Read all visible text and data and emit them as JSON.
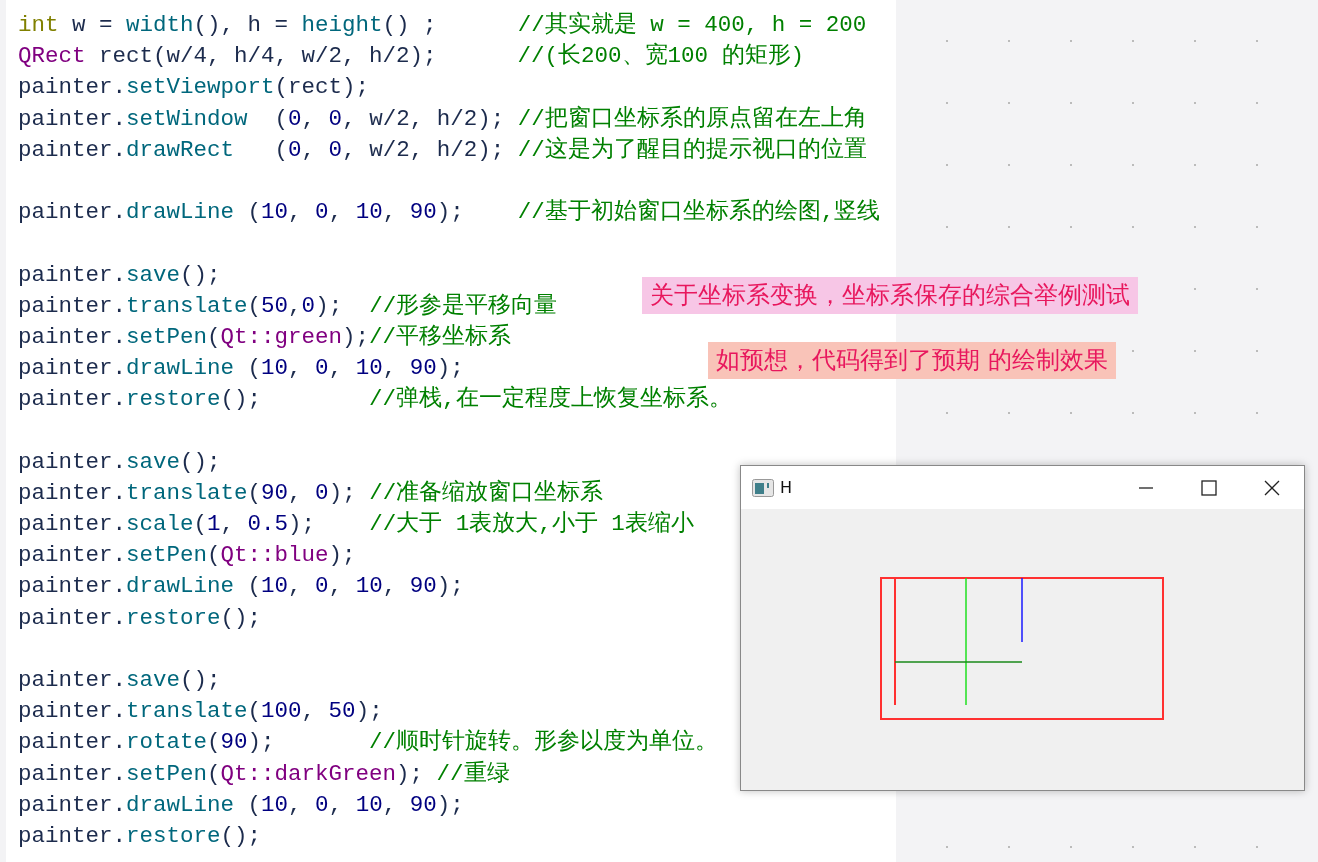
{
  "code_lines": [
    {
      "kind": "code",
      "tokens": [
        {
          "kind": "kw",
          "text": "int"
        },
        {
          "kind": "var",
          "text": " w = "
        },
        {
          "kind": "fn",
          "text": "width"
        },
        {
          "kind": "var",
          "text": "(), h = "
        },
        {
          "kind": "fn",
          "text": "height"
        },
        {
          "kind": "var",
          "text": "() ;      "
        },
        {
          "kind": "com",
          "text": "//其实就是 w = 400, h = 200"
        }
      ]
    },
    {
      "kind": "code",
      "tokens": [
        {
          "kind": "type",
          "text": "QRect"
        },
        {
          "kind": "var",
          "text": " rect(w/4, h/4, w/2, h/2);      "
        },
        {
          "kind": "com",
          "text": "//(长200、宽100 的矩形)"
        }
      ]
    },
    {
      "kind": "code",
      "tokens": [
        {
          "kind": "var",
          "text": "painter."
        },
        {
          "kind": "fn",
          "text": "setViewport"
        },
        {
          "kind": "var",
          "text": "(rect);"
        }
      ]
    },
    {
      "kind": "code",
      "tokens": [
        {
          "kind": "var",
          "text": "painter."
        },
        {
          "kind": "fn",
          "text": "setWindow"
        },
        {
          "kind": "var",
          "text": "  ("
        },
        {
          "kind": "num",
          "text": "0"
        },
        {
          "kind": "var",
          "text": ", "
        },
        {
          "kind": "num",
          "text": "0"
        },
        {
          "kind": "var",
          "text": ", w/2, h/2); "
        },
        {
          "kind": "com",
          "text": "//把窗口坐标系的原点留在左上角"
        }
      ]
    },
    {
      "kind": "code",
      "tokens": [
        {
          "kind": "var",
          "text": "painter."
        },
        {
          "kind": "fn",
          "text": "drawRect"
        },
        {
          "kind": "var",
          "text": "   ("
        },
        {
          "kind": "num",
          "text": "0"
        },
        {
          "kind": "var",
          "text": ", "
        },
        {
          "kind": "num",
          "text": "0"
        },
        {
          "kind": "var",
          "text": ", w/2, h/2); "
        },
        {
          "kind": "com",
          "text": "//这是为了醒目的提示视口的位置"
        }
      ]
    },
    {
      "kind": "blank"
    },
    {
      "kind": "code",
      "tokens": [
        {
          "kind": "var",
          "text": "painter."
        },
        {
          "kind": "fn",
          "text": "drawLine"
        },
        {
          "kind": "var",
          "text": " ("
        },
        {
          "kind": "num",
          "text": "10"
        },
        {
          "kind": "var",
          "text": ", "
        },
        {
          "kind": "num",
          "text": "0"
        },
        {
          "kind": "var",
          "text": ", "
        },
        {
          "kind": "num",
          "text": "10"
        },
        {
          "kind": "var",
          "text": ", "
        },
        {
          "kind": "num",
          "text": "90"
        },
        {
          "kind": "var",
          "text": ");    "
        },
        {
          "kind": "com",
          "text": "//基于初始窗口坐标系的绘图,竖线"
        }
      ]
    },
    {
      "kind": "blank"
    },
    {
      "kind": "code",
      "tokens": [
        {
          "kind": "var",
          "text": "painter."
        },
        {
          "kind": "fn",
          "text": "save"
        },
        {
          "kind": "var",
          "text": "();"
        }
      ]
    },
    {
      "kind": "code",
      "tokens": [
        {
          "kind": "var",
          "text": "painter."
        },
        {
          "kind": "fn",
          "text": "translate"
        },
        {
          "kind": "var",
          "text": "("
        },
        {
          "kind": "num",
          "text": "50"
        },
        {
          "kind": "var",
          "text": ","
        },
        {
          "kind": "num",
          "text": "0"
        },
        {
          "kind": "var",
          "text": ");  "
        },
        {
          "kind": "com",
          "text": "//形参是平移向量"
        }
      ]
    },
    {
      "kind": "code",
      "tokens": [
        {
          "kind": "var",
          "text": "painter."
        },
        {
          "kind": "fn",
          "text": "setPen"
        },
        {
          "kind": "var",
          "text": "("
        },
        {
          "kind": "type",
          "text": "Qt::green"
        },
        {
          "kind": "var",
          "text": ");"
        },
        {
          "kind": "com",
          "text": "//平移坐标系"
        }
      ]
    },
    {
      "kind": "code",
      "tokens": [
        {
          "kind": "var",
          "text": "painter."
        },
        {
          "kind": "fn",
          "text": "drawLine"
        },
        {
          "kind": "var",
          "text": " ("
        },
        {
          "kind": "num",
          "text": "10"
        },
        {
          "kind": "var",
          "text": ", "
        },
        {
          "kind": "num",
          "text": "0"
        },
        {
          "kind": "var",
          "text": ", "
        },
        {
          "kind": "num",
          "text": "10"
        },
        {
          "kind": "var",
          "text": ", "
        },
        {
          "kind": "num",
          "text": "90"
        },
        {
          "kind": "var",
          "text": ");"
        }
      ]
    },
    {
      "kind": "code",
      "tokens": [
        {
          "kind": "var",
          "text": "painter."
        },
        {
          "kind": "fn",
          "text": "restore"
        },
        {
          "kind": "var",
          "text": "();        "
        },
        {
          "kind": "com",
          "text": "//弹栈,在一定程度上恢复坐标系。"
        }
      ]
    },
    {
      "kind": "blank"
    },
    {
      "kind": "code",
      "tokens": [
        {
          "kind": "var",
          "text": "painter."
        },
        {
          "kind": "fn",
          "text": "save"
        },
        {
          "kind": "var",
          "text": "();"
        }
      ]
    },
    {
      "kind": "code",
      "tokens": [
        {
          "kind": "var",
          "text": "painter."
        },
        {
          "kind": "fn",
          "text": "translate"
        },
        {
          "kind": "var",
          "text": "("
        },
        {
          "kind": "num",
          "text": "90"
        },
        {
          "kind": "var",
          "text": ", "
        },
        {
          "kind": "num",
          "text": "0"
        },
        {
          "kind": "var",
          "text": "); "
        },
        {
          "kind": "com",
          "text": "//准备缩放窗口坐标系"
        }
      ]
    },
    {
      "kind": "code",
      "tokens": [
        {
          "kind": "var",
          "text": "painter."
        },
        {
          "kind": "fn",
          "text": "scale"
        },
        {
          "kind": "var",
          "text": "("
        },
        {
          "kind": "num",
          "text": "1"
        },
        {
          "kind": "var",
          "text": ", "
        },
        {
          "kind": "num",
          "text": "0.5"
        },
        {
          "kind": "var",
          "text": ");    "
        },
        {
          "kind": "com",
          "text": "//大于 1表放大,小于 1表缩小"
        }
      ]
    },
    {
      "kind": "code",
      "tokens": [
        {
          "kind": "var",
          "text": "painter."
        },
        {
          "kind": "fn",
          "text": "setPen"
        },
        {
          "kind": "var",
          "text": "("
        },
        {
          "kind": "type",
          "text": "Qt::blue"
        },
        {
          "kind": "var",
          "text": ");"
        }
      ]
    },
    {
      "kind": "code",
      "tokens": [
        {
          "kind": "var",
          "text": "painter."
        },
        {
          "kind": "fn",
          "text": "drawLine"
        },
        {
          "kind": "var",
          "text": " ("
        },
        {
          "kind": "num",
          "text": "10"
        },
        {
          "kind": "var",
          "text": ", "
        },
        {
          "kind": "num",
          "text": "0"
        },
        {
          "kind": "var",
          "text": ", "
        },
        {
          "kind": "num",
          "text": "10"
        },
        {
          "kind": "var",
          "text": ", "
        },
        {
          "kind": "num",
          "text": "90"
        },
        {
          "kind": "var",
          "text": ");"
        }
      ]
    },
    {
      "kind": "code",
      "tokens": [
        {
          "kind": "var",
          "text": "painter."
        },
        {
          "kind": "fn",
          "text": "restore"
        },
        {
          "kind": "var",
          "text": "();"
        }
      ]
    },
    {
      "kind": "blank"
    },
    {
      "kind": "code",
      "tokens": [
        {
          "kind": "var",
          "text": "painter."
        },
        {
          "kind": "fn",
          "text": "save"
        },
        {
          "kind": "var",
          "text": "();"
        }
      ]
    },
    {
      "kind": "code",
      "tokens": [
        {
          "kind": "var",
          "text": "painter."
        },
        {
          "kind": "fn",
          "text": "translate"
        },
        {
          "kind": "var",
          "text": "("
        },
        {
          "kind": "num",
          "text": "100"
        },
        {
          "kind": "var",
          "text": ", "
        },
        {
          "kind": "num",
          "text": "50"
        },
        {
          "kind": "var",
          "text": ");"
        }
      ]
    },
    {
      "kind": "code",
      "tokens": [
        {
          "kind": "var",
          "text": "painter."
        },
        {
          "kind": "fn",
          "text": "rotate"
        },
        {
          "kind": "var",
          "text": "("
        },
        {
          "kind": "num",
          "text": "90"
        },
        {
          "kind": "var",
          "text": ");       "
        },
        {
          "kind": "com",
          "text": "//顺时针旋转。形参以度为单位。"
        }
      ]
    },
    {
      "kind": "code",
      "tokens": [
        {
          "kind": "var",
          "text": "painter."
        },
        {
          "kind": "fn",
          "text": "setPen"
        },
        {
          "kind": "var",
          "text": "("
        },
        {
          "kind": "type",
          "text": "Qt::darkGreen"
        },
        {
          "kind": "var",
          "text": "); "
        },
        {
          "kind": "com",
          "text": "//重绿"
        }
      ]
    },
    {
      "kind": "code",
      "tokens": [
        {
          "kind": "var",
          "text": "painter."
        },
        {
          "kind": "fn",
          "text": "drawLine"
        },
        {
          "kind": "var",
          "text": " ("
        },
        {
          "kind": "num",
          "text": "10"
        },
        {
          "kind": "var",
          "text": ", "
        },
        {
          "kind": "num",
          "text": "0"
        },
        {
          "kind": "var",
          "text": ", "
        },
        {
          "kind": "num",
          "text": "10"
        },
        {
          "kind": "var",
          "text": ", "
        },
        {
          "kind": "num",
          "text": "90"
        },
        {
          "kind": "var",
          "text": ");"
        }
      ]
    },
    {
      "kind": "code",
      "tokens": [
        {
          "kind": "var",
          "text": "painter."
        },
        {
          "kind": "fn",
          "text": "restore"
        },
        {
          "kind": "var",
          "text": "();"
        }
      ]
    }
  ],
  "annotations": [
    {
      "text": "关于坐标系变换，坐标系保存的综合举例测试",
      "color": "#f7c6e6"
    },
    {
      "text": "如预想，代码得到了预期 的绘制效果",
      "color": "#f9c3b8"
    }
  ],
  "qt_window": {
    "title": "H"
  }
}
